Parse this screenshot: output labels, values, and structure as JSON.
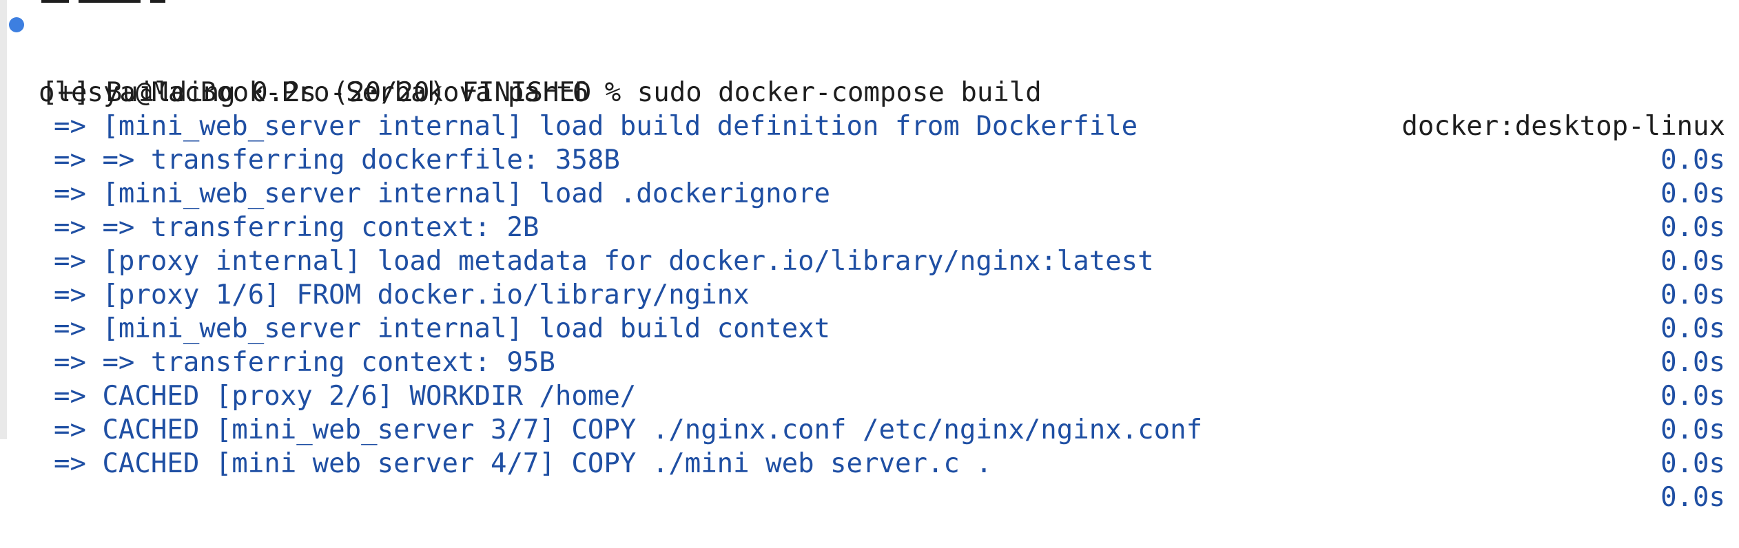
{
  "terminal": {
    "prompt": {
      "user_host": "olesya@MacBook-Pro-Serbakova",
      "cwd": "part6",
      "symbol": "%",
      "command": "sudo docker-compose build",
      "full": "olesya@MacBook-Pro-Serbakova part6 % sudo docker-compose build"
    },
    "build_header": {
      "status": "[+] Building 0.2s (20/20) FINISHED",
      "context": "docker:desktop-linux"
    },
    "steps": [
      {
        "text": "=> [mini_web_server internal] load build definition from Dockerfile",
        "time": "0.0s"
      },
      {
        "text": "=> => transferring dockerfile: 358B",
        "time": "0.0s"
      },
      {
        "text": "=> [mini_web_server internal] load .dockerignore",
        "time": "0.0s"
      },
      {
        "text": "=> => transferring context: 2B",
        "time": "0.0s"
      },
      {
        "text": "=> [proxy internal] load metadata for docker.io/library/nginx:latest",
        "time": "0.0s"
      },
      {
        "text": "=> [proxy 1/6] FROM docker.io/library/nginx",
        "time": "0.0s"
      },
      {
        "text": "=> [mini_web_server internal] load build context",
        "time": "0.0s"
      },
      {
        "text": "=> => transferring context: 95B",
        "time": "0.0s"
      },
      {
        "text": "=> CACHED [proxy 2/6] WORKDIR /home/",
        "time": "0.0s"
      },
      {
        "text": "=> CACHED [mini_web_server 3/7] COPY ./nginx.conf /etc/nginx/nginx.conf",
        "time": "0.0s"
      },
      {
        "text": "=> CACHED [mini web server 4/7] COPY ./mini web server.c .",
        "time": "0.0s"
      }
    ]
  },
  "colors": {
    "background": "#ffffff",
    "text": "#1e1e1e",
    "step_text": "#1f4fa3",
    "prompt_dot": "#3d7fe0",
    "gutter": "#e9e9e9"
  },
  "icons": {
    "prompt_marker": "command-status-dot-icon"
  }
}
